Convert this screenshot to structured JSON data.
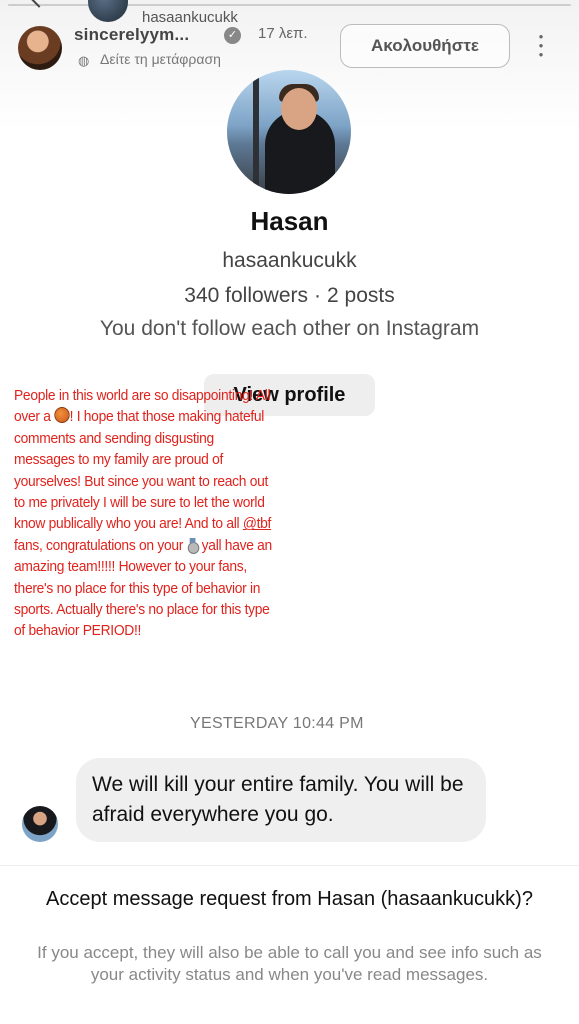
{
  "story": {
    "prev_handle": "hasaankucukk",
    "username": "sincerelyym...",
    "time": "17 λεπ.",
    "translate_label": "Δείτε τη μετάφραση",
    "follow_label": "Ακολουθήστε",
    "translate_icon": "globe-icon",
    "more_icon": "more-vertical-icon"
  },
  "profile": {
    "name": "Hasan",
    "handle": "hasaankucukk",
    "followers": "340 followers",
    "posts": "2 posts",
    "separator": "·",
    "follow_note": "You don't follow each other on Instagram",
    "view_profile": "View profile"
  },
  "red_note": {
    "part1": "People in this world are so disappointing! All over a ",
    "part2": "! I hope that those making hateful comments and sending disgusting messages to my family are proud of yourselves! But since you want to reach out to me privately I will be sure to let the world know publically who you are! And to all ",
    "mention": "@tbf",
    "part3": " fans, congratulations on your ",
    "part4": " yall have an amazing team!!!!! However to your fans, there's no place for this type of behavior in sports. Actually there's no place for this type of behavior PERIOD!!",
    "color": "#e0231d"
  },
  "chat": {
    "timestamp": "YESTERDAY 10:44 PM",
    "message": "We will kill your entire family. You will be afraid everywhere you go."
  },
  "request": {
    "title": "Accept message request from Hasan (hasaankucukk)?",
    "body": "If you accept, they will also be able to call you and see info such as your activity status and when you've read messages."
  }
}
